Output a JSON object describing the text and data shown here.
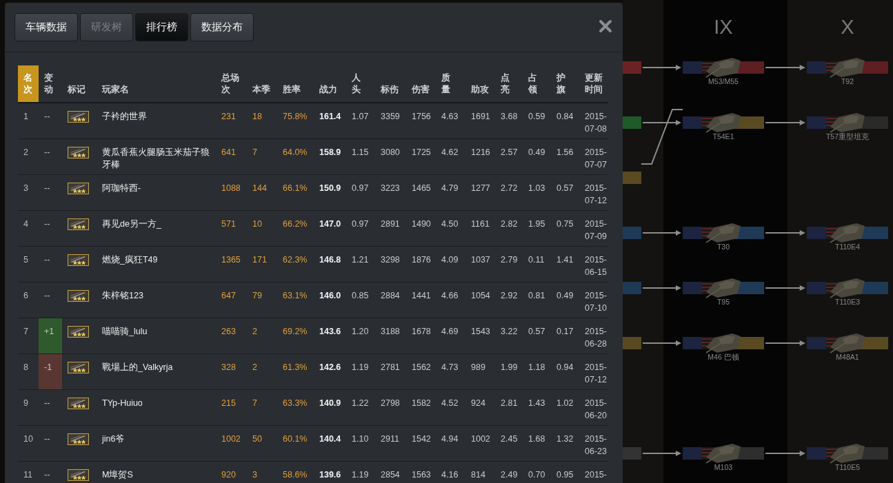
{
  "tabs": [
    {
      "label": "车辆数据",
      "selected": false,
      "disabled": false
    },
    {
      "label": "研发树",
      "selected": false,
      "disabled": true
    },
    {
      "label": "排行榜",
      "selected": true,
      "disabled": false
    },
    {
      "label": "数据分布",
      "selected": false,
      "disabled": false
    }
  ],
  "table": {
    "columns": [
      {
        "label": "名次",
        "sorted": true
      },
      {
        "label": "变动",
        "sorted": false
      },
      {
        "label": "标记",
        "sorted": false
      },
      {
        "label": "玩家名",
        "sorted": false
      },
      {
        "label": "总场次",
        "sorted": false
      },
      {
        "label": "本季",
        "sorted": false
      },
      {
        "label": "胜率",
        "sorted": false
      },
      {
        "label": "战力",
        "sorted": false
      },
      {
        "label": "人头",
        "sorted": false
      },
      {
        "label": "标伤",
        "sorted": false
      },
      {
        "label": "伤害",
        "sorted": false
      },
      {
        "label": "质量",
        "sorted": false
      },
      {
        "label": "助攻",
        "sorted": false
      },
      {
        "label": "点亮",
        "sorted": false
      },
      {
        "label": "占领",
        "sorted": false
      },
      {
        "label": "护旗",
        "sorted": false
      },
      {
        "label": "更新时间",
        "sorted": false
      }
    ],
    "rows": [
      {
        "rank": "1",
        "change": "--",
        "up": false,
        "down": false,
        "name": "子衿的世界",
        "stats": [
          "231",
          "18",
          "75.8%",
          "161.4",
          "1.07",
          "3359",
          "1756",
          "4.63",
          "1691",
          "3.68",
          "0.59",
          "0.84",
          "2015-07-08"
        ]
      },
      {
        "rank": "2",
        "change": "--",
        "up": false,
        "down": false,
        "name": "黄瓜香蕉火腿肠玉米茄子狼牙棒",
        "stats": [
          "641",
          "7",
          "64.0%",
          "158.9",
          "1.15",
          "3080",
          "1725",
          "4.62",
          "1216",
          "2.57",
          "0.49",
          "1.56",
          "2015-07-07"
        ]
      },
      {
        "rank": "3",
        "change": "--",
        "up": false,
        "down": false,
        "name": "阿珈特西-",
        "stats": [
          "1088",
          "144",
          "66.1%",
          "150.9",
          "0.97",
          "3223",
          "1465",
          "4.79",
          "1277",
          "2.72",
          "1.03",
          "0.57",
          "2015-07-12"
        ]
      },
      {
        "rank": "4",
        "change": "--",
        "up": false,
        "down": false,
        "name": "再见de另一方_",
        "stats": [
          "571",
          "10",
          "66.2%",
          "147.0",
          "0.97",
          "2891",
          "1490",
          "4.50",
          "1161",
          "2.82",
          "1.95",
          "0.75",
          "2015-07-09"
        ]
      },
      {
        "rank": "5",
        "change": "--",
        "up": false,
        "down": false,
        "name": "燃烧_疯狂T49",
        "stats": [
          "1365",
          "171",
          "62.3%",
          "146.8",
          "1.21",
          "3298",
          "1876",
          "4.09",
          "1037",
          "2.79",
          "0.11",
          "1.41",
          "2015-06-15"
        ]
      },
      {
        "rank": "6",
        "change": "--",
        "up": false,
        "down": false,
        "name": "朱梓铭123",
        "stats": [
          "647",
          "79",
          "63.1%",
          "146.0",
          "0.85",
          "2884",
          "1441",
          "4.66",
          "1054",
          "2.92",
          "0.81",
          "0.49",
          "2015-07-10"
        ]
      },
      {
        "rank": "7",
        "change": "+1",
        "up": true,
        "down": false,
        "name": "喵喵骑_lulu",
        "stats": [
          "263",
          "2",
          "69.2%",
          "143.6",
          "1.20",
          "3188",
          "1678",
          "4.69",
          "1543",
          "3.22",
          "0.57",
          "0.17",
          "2015-06-28"
        ]
      },
      {
        "rank": "8",
        "change": "-1",
        "up": false,
        "down": true,
        "name": "戰場上的_Valkyrja",
        "stats": [
          "328",
          "2",
          "61.3%",
          "142.6",
          "1.19",
          "2781",
          "1562",
          "4.73",
          "989",
          "1.99",
          "1.18",
          "0.94",
          "2015-07-12"
        ]
      },
      {
        "rank": "9",
        "change": "--",
        "up": false,
        "down": false,
        "name": "TYp-Huiuo",
        "stats": [
          "215",
          "7",
          "63.3%",
          "140.9",
          "1.22",
          "2798",
          "1582",
          "4.52",
          "924",
          "2.81",
          "1.43",
          "1.02",
          "2015-06-20"
        ]
      },
      {
        "rank": "10",
        "change": "--",
        "up": false,
        "down": false,
        "name": "jin6爷",
        "stats": [
          "1002",
          "50",
          "60.1%",
          "140.4",
          "1.10",
          "2911",
          "1542",
          "4.94",
          "1002",
          "2.45",
          "1.68",
          "1.32",
          "2015-06-23"
        ]
      },
      {
        "rank": "11",
        "change": "--",
        "up": false,
        "down": false,
        "name": "M埠贺S",
        "stats": [
          "920",
          "3",
          "58.6%",
          "139.6",
          "1.19",
          "2854",
          "1563",
          "4.16",
          "814",
          "2.49",
          "0.70",
          "0.95",
          "2015-"
        ]
      }
    ]
  },
  "tech_tree": {
    "tiers": [
      "IX",
      "X"
    ],
    "rows": [
      {
        "kind": "nodes",
        "stub": {
          "color": "#6a2226"
        },
        "merge_up": false,
        "nodes": [
          {
            "name": "M53/M55",
            "color": "#5e1e22"
          },
          {
            "name": "T92",
            "color": "#5e1e22"
          }
        ]
      },
      {
        "kind": "nodes",
        "stub": {
          "color": "#1f5a2a"
        },
        "merge_up": false,
        "nodes": [
          {
            "name": "T54E1",
            "color": "#5a4a22"
          },
          {
            "name": "T57重型坦克",
            "color": "#2a2a2a"
          }
        ]
      },
      {
        "kind": "stub",
        "stub": {
          "color": "#5a4a22"
        },
        "merge_up": true,
        "nodes": []
      },
      {
        "kind": "nodes",
        "stub": {
          "color": "#1e3a57"
        },
        "merge_up": false,
        "nodes": [
          {
            "name": "T30",
            "color": "#1e3a57"
          },
          {
            "name": "T110E4",
            "color": "#1e3a57"
          }
        ]
      },
      {
        "kind": "nodes",
        "stub": {
          "color": "#1e3a57"
        },
        "merge_up": false,
        "nodes": [
          {
            "name": "T95",
            "color": "#1e3a57"
          },
          {
            "name": "T110E3",
            "color": "#1e3a57"
          }
        ]
      },
      {
        "kind": "nodes",
        "stub": {
          "color": "#5a4a22"
        },
        "merge_up": false,
        "nodes": [
          {
            "name": "M46 巴顿",
            "color": "#5a4a22"
          },
          {
            "name": "M48A1",
            "color": "#5a4a22"
          }
        ]
      },
      {
        "kind": "empty",
        "nodes": []
      },
      {
        "kind": "nodes",
        "stub": {
          "color": "#333333"
        },
        "merge_up": false,
        "nodes": [
          {
            "name": "M103",
            "color": "#2e2e2e"
          },
          {
            "name": "T110E5",
            "color": "#2e2e2e"
          }
        ]
      }
    ]
  }
}
